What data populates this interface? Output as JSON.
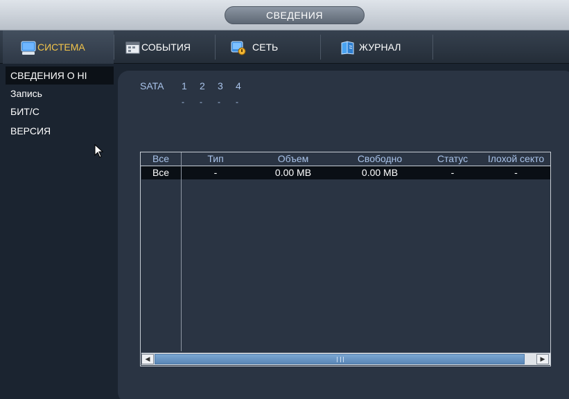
{
  "window": {
    "title": "СВЕДЕНИЯ"
  },
  "tabs": [
    {
      "label": "СИСТЕМА",
      "icon": "system-monitor-icon",
      "active": true
    },
    {
      "label": "СОБЫТИЯ",
      "icon": "events-calendar-icon",
      "active": false
    },
    {
      "label": "СЕТЬ",
      "icon": "network-icon",
      "active": false
    },
    {
      "label": "ЖУРНАЛ",
      "icon": "journal-book-icon",
      "active": false
    }
  ],
  "sidebar": {
    "items": [
      {
        "label": "СВЕДЕНИЯ О НІ",
        "active": true
      },
      {
        "label": "Запись",
        "active": false
      },
      {
        "label": "БИТ/С",
        "active": false
      },
      {
        "label": "ВЕРСИЯ",
        "active": false
      }
    ]
  },
  "sata": {
    "label": "SATA",
    "ports": [
      "1",
      "2",
      "3",
      "4"
    ],
    "statuses": [
      "-",
      "-",
      "-",
      "-"
    ]
  },
  "table": {
    "columns": [
      "Все",
      "Тип",
      "Объем",
      "Свободно",
      "Статус",
      "Ілохой секто"
    ],
    "rows": [
      [
        "Все",
        "-",
        "0.00 MB",
        "0.00 MB",
        "-",
        "-"
      ]
    ]
  },
  "colors": {
    "accent_active_tab": "#f2c44a",
    "header_text": "#a9c3ea",
    "background": "#1b2430",
    "panel": "#2a3443"
  }
}
